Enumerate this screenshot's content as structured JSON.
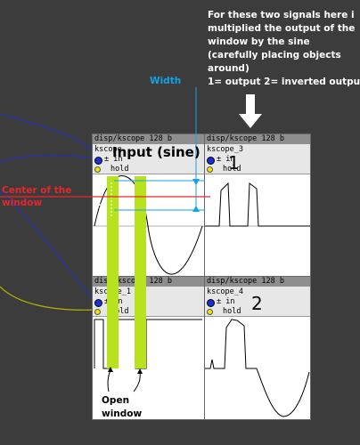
{
  "note": {
    "lines": [
      "For these two signals here i",
      "multiplied the output of the",
      "window by the sine",
      "(carefully placing objects",
      "around)",
      "1= output 2= inverted output"
    ]
  },
  "annotations": {
    "width_label": "Width",
    "center_line1": "Center of the",
    "center_line2": "window",
    "input_label": "Input (sine)",
    "open_line1": "Open",
    "open_line2": "window",
    "num1": "1",
    "num2": "2"
  },
  "scopes": [
    {
      "title": "disp/kscope 128 b",
      "name": "kscope",
      "in_label": "± in",
      "hold_label": "hold"
    },
    {
      "title": "disp/kscope 128 b",
      "name": "kscope_3",
      "in_label": "± in",
      "hold_label": "hold"
    },
    {
      "title": "disp/kscope 128 b",
      "name": "kscope_1",
      "in_label": "± in",
      "hold_label": "hold"
    },
    {
      "title": "disp/kscope 128 b",
      "name": "kscope_4",
      "in_label": "± in",
      "hold_label": "hold"
    }
  ],
  "colors": {
    "background": "#3c3c3c",
    "highlight_green": "#b9e21e",
    "center_red": "#e8262b",
    "width_blue": "#16a2e6",
    "patch_cord_blue": "#2430b0",
    "patch_cord_yellow": "#b7b300"
  },
  "icons": {
    "down_arrow": "arrow-down-icon",
    "inlet_dot": "inlet-dot-icon",
    "hold_dot": "hold-dot-icon"
  }
}
